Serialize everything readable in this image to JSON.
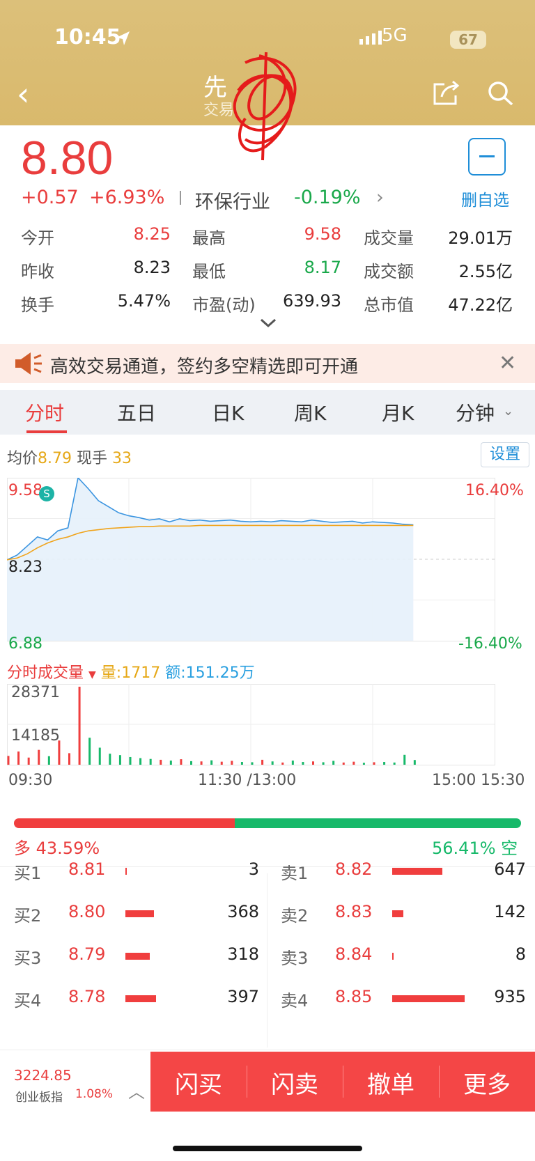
{
  "status_bar": {
    "time": "10:45",
    "network": "5G",
    "battery": "67"
  },
  "header": {
    "title": "先",
    "subtitle": "交易"
  },
  "quote": {
    "price": "8.80",
    "change": "+0.57",
    "change_pct": "+6.93%",
    "industry": "环保行业",
    "industry_pct": "-0.19%",
    "fav_label": "删自选"
  },
  "stats": {
    "open_label": "今开",
    "open": "8.25",
    "high_label": "最高",
    "high": "9.58",
    "volume_label": "成交量",
    "volume": "29.01万",
    "prev_close_label": "昨收",
    "prev_close": "8.23",
    "low_label": "最低",
    "low": "8.17",
    "amount_label": "成交额",
    "amount": "2.55亿",
    "turnover_label": "换手",
    "turnover": "5.47%",
    "pe_label": "市盈(动)",
    "pe": "639.93",
    "mktcap_label": "总市值",
    "mktcap": "47.22亿"
  },
  "banner": {
    "text": "高效交易通道，签约多空精选即可开通"
  },
  "tabs": [
    "分时",
    "五日",
    "日K",
    "周K",
    "月K",
    "分钟"
  ],
  "info": {
    "avg_label": "均价",
    "avg": "8.79",
    "cur_label": "现手",
    "cur": "33",
    "settings": "设置"
  },
  "chart": {
    "y_top": "9.58",
    "y_mid": "8.23",
    "y_bot": "6.88",
    "pct_top": "16.40%",
    "pct_bot": "-16.40%",
    "marker": "S",
    "vol_title": "分时成交量",
    "vol_qty": "量:1717",
    "vol_amt": "额:151.25万",
    "vol_max": "28371",
    "vol_mid": "14185",
    "times": [
      "09:30",
      "11:30 /13:00",
      "15:00",
      "15:30"
    ]
  },
  "chart_data": {
    "type": "line",
    "ylim": [
      6.88,
      9.58
    ],
    "prev_close": 8.23,
    "series": [
      {
        "values": [
          8.22,
          8.3,
          8.45,
          8.6,
          8.55,
          8.7,
          8.75,
          9.58,
          9.4,
          9.2,
          9.1,
          9.0,
          8.95,
          8.92,
          8.88,
          8.9,
          8.85,
          8.9,
          8.87,
          8.88,
          8.86,
          8.87,
          8.88,
          8.86,
          8.85,
          8.86,
          8.85,
          8.87,
          8.86,
          8.85,
          8.88,
          8.86,
          8.84,
          8.85,
          8.86,
          8.83,
          8.85,
          8.84,
          8.83,
          8.81,
          8.8
        ]
      },
      {
        "values": [
          8.22,
          8.25,
          8.32,
          8.42,
          8.5,
          8.56,
          8.6,
          8.66,
          8.7,
          8.72,
          8.74,
          8.75,
          8.76,
          8.77,
          8.77,
          8.78,
          8.78,
          8.78,
          8.78,
          8.79,
          8.79,
          8.79,
          8.79,
          8.79,
          8.79,
          8.79,
          8.79,
          8.79,
          8.79,
          8.79,
          8.79,
          8.79,
          8.79,
          8.79,
          8.79,
          8.79,
          8.79,
          8.79,
          8.79,
          8.79,
          8.79
        ]
      }
    ],
    "volume": [
      3200,
      4800,
      2600,
      5400,
      3100,
      8800,
      4200,
      28371,
      9800,
      6200,
      4000,
      3500,
      2800,
      2400,
      2100,
      1800,
      1500,
      2000,
      1300,
      1200,
      1600,
      1100,
      1400,
      1000,
      900,
      1800,
      1200,
      800,
      1500,
      1000,
      1200,
      900,
      1400,
      800,
      1100,
      700,
      900,
      1000,
      800,
      3600,
      1717
    ]
  },
  "sentiment": {
    "bull": "多 43.59%",
    "bull_ratio": 0.4359,
    "bear": "56.41% 空"
  },
  "orderbook": {
    "bids": [
      {
        "label": "买1",
        "price": "8.81",
        "vol": "3"
      },
      {
        "label": "买2",
        "price": "8.80",
        "vol": "368"
      },
      {
        "label": "买3",
        "price": "8.79",
        "vol": "318"
      },
      {
        "label": "买4",
        "price": "8.78",
        "vol": "397"
      }
    ],
    "asks": [
      {
        "label": "卖1",
        "price": "8.82",
        "vol": "647"
      },
      {
        "label": "卖2",
        "price": "8.83",
        "vol": "142"
      },
      {
        "label": "卖3",
        "price": "8.84",
        "vol": "8"
      },
      {
        "label": "卖4",
        "price": "8.85",
        "vol": "935"
      }
    ]
  },
  "footer": {
    "index_value": "3224.85",
    "index_name": "创业板指",
    "index_pct": "1.08%",
    "actions": [
      "闪买",
      "闪卖",
      "撤单",
      "更多"
    ]
  }
}
